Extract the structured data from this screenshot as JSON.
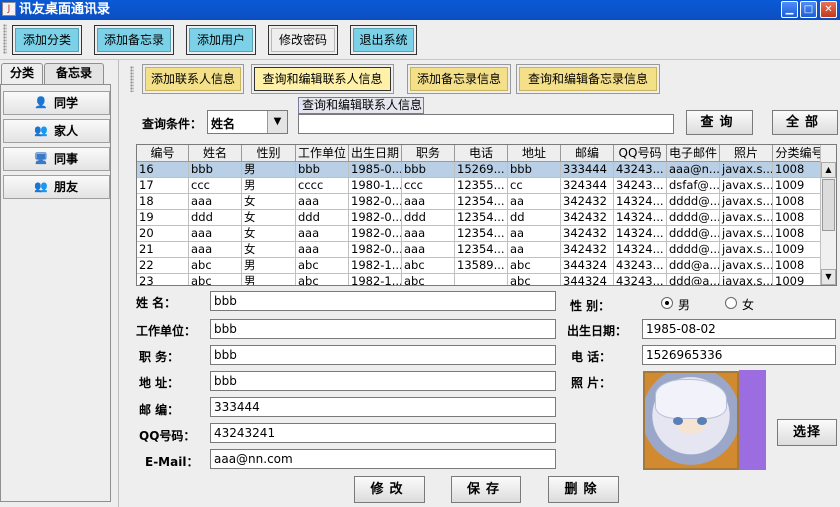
{
  "window": {
    "title": "讯友桌面通讯录",
    "app_icon": "J"
  },
  "toolbar": {
    "buttons": [
      {
        "label": "添加分类"
      },
      {
        "label": "添加备忘录"
      },
      {
        "label": "添加用户"
      },
      {
        "label": "修改密码"
      },
      {
        "label": "退出系统"
      }
    ]
  },
  "left_tabs": {
    "tab1": "分类",
    "tab2": "备忘录"
  },
  "categories": [
    {
      "label": "同学",
      "icon": "classmates-icon"
    },
    {
      "label": "家人",
      "icon": "family-icon"
    },
    {
      "label": "同事",
      "icon": "colleagues-icon"
    },
    {
      "label": "朋友",
      "icon": "friends-icon"
    }
  ],
  "subtoolbar": {
    "buttons": [
      {
        "label": "添加联系人信息"
      },
      {
        "label": "查询和编辑联系人信息"
      },
      {
        "label": "添加备忘录信息"
      },
      {
        "label": "查询和编辑备忘录信息"
      }
    ]
  },
  "search": {
    "label": "查询条件：",
    "field_value": "姓名",
    "tooltip": "查询和编辑联系人信息",
    "input_value": "",
    "query_button": "查询",
    "all_button": "全部"
  },
  "table": {
    "columns": [
      "编号",
      "姓名",
      "性别",
      "工作单位",
      "出生日期",
      "职务",
      "电话",
      "地址",
      "邮编",
      "QQ号码",
      "电子邮件",
      "照片",
      "分类编号"
    ],
    "rows": [
      [
        "16",
        "bbb",
        "男",
        "bbb",
        "1985-0...",
        "bbb",
        "15269...",
        "bbb",
        "333444",
        "43243...",
        "aaa@n...",
        "javax.s...",
        "1008"
      ],
      [
        "17",
        "ccc",
        "男",
        "cccc",
        "1980-1...",
        "ccc",
        "12355...",
        "cc",
        "324344",
        "34243...",
        "dsfaf@...",
        "javax.s...",
        "1009"
      ],
      [
        "18",
        "aaa",
        "女",
        "aaa",
        "1982-0...",
        "aaa",
        "12354...",
        "aa",
        "342432",
        "14324...",
        "dddd@...",
        "javax.s...",
        "1008"
      ],
      [
        "19",
        "ddd",
        "女",
        "ddd",
        "1982-0...",
        "ddd",
        "12354...",
        "dd",
        "342432",
        "14324...",
        "dddd@...",
        "javax.s...",
        "1008"
      ],
      [
        "20",
        "aaa",
        "女",
        "aaa",
        "1982-0...",
        "aaa",
        "12354...",
        "aa",
        "342432",
        "14324...",
        "dddd@...",
        "javax.s...",
        "1008"
      ],
      [
        "21",
        "aaa",
        "女",
        "aaa",
        "1982-0...",
        "aaa",
        "12354...",
        "aa",
        "342432",
        "14324...",
        "dddd@...",
        "javax.s...",
        "1009"
      ],
      [
        "22",
        "abc",
        "男",
        "abc",
        "1982-1...",
        "abc",
        "13589...",
        "abc",
        "344324",
        "43243...",
        "ddd@a...",
        "javax.s...",
        "1008"
      ],
      [
        "23",
        "abc",
        "男",
        "abc",
        "1982-1...",
        "abc",
        "",
        "abc",
        "344324",
        "43243...",
        "ddd@a...",
        "javax.s...",
        "1009"
      ]
    ],
    "selected_row": 0
  },
  "form": {
    "name_label": "姓    名：",
    "name_value": "bbb",
    "gender_label": "性    别：",
    "gender_male": "男",
    "gender_female": "女",
    "gender_selected": "男",
    "company_label": "工作单位：",
    "company_value": "bbb",
    "birth_label": "出生日期：",
    "birth_value": "1985-08-02",
    "position_label": "职    务：",
    "position_value": "bbb",
    "phone_label": "电    话：",
    "phone_value": "1526965336",
    "address_label": "地    址：",
    "address_value": "bbb",
    "photo_label": "照    片：",
    "zip_label": "邮    编：",
    "zip_value": "333444",
    "qq_label": "QQ号码：",
    "qq_value": "43243241",
    "email_label": "E-Mail：",
    "email_value": "aaa@nn.com",
    "choose_button": "选择",
    "edit_button": "修改",
    "save_button": "保存",
    "delete_button": "删除"
  }
}
